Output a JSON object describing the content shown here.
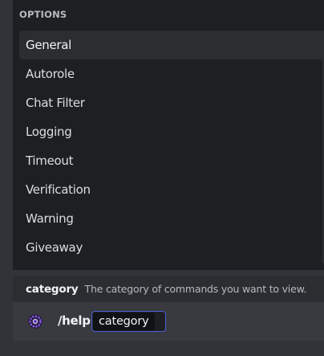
{
  "options_panel": {
    "header": "OPTIONS",
    "selected_index": 0,
    "items": [
      {
        "label": "General"
      },
      {
        "label": "Autorole"
      },
      {
        "label": "Chat Filter"
      },
      {
        "label": "Logging"
      },
      {
        "label": "Timeout"
      },
      {
        "label": "Verification"
      },
      {
        "label": "Warning"
      },
      {
        "label": "Giveaway"
      }
    ]
  },
  "hint": {
    "param_name": "category",
    "param_description": "The category of commands you want to view."
  },
  "command_input": {
    "bot_icon": "bot-avatar-icon",
    "command": "/help",
    "param_value": "category",
    "accent_color": "#4e5fd6"
  }
}
